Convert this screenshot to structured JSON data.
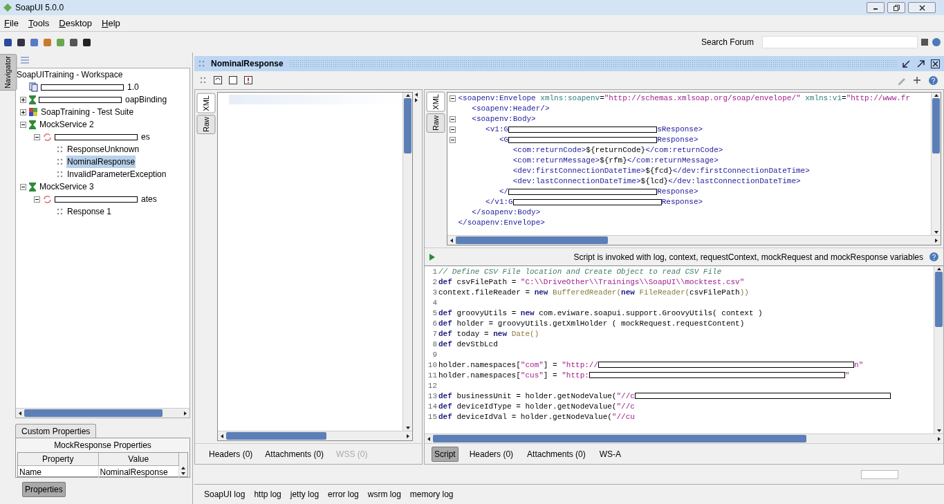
{
  "window": {
    "title": "SoapUI 5.0.0"
  },
  "menu": [
    {
      "label": "File"
    },
    {
      "label": "Tools"
    },
    {
      "label": "Desktop"
    },
    {
      "label": "Help"
    }
  ],
  "toolbar": {
    "search_label": "Search Forum"
  },
  "navigator": {
    "tab": "Navigator",
    "tree": [
      {
        "kind": "workspace",
        "label": "SoapUITraining - Workspace",
        "selected": false,
        "children": [
          {
            "kind": "project",
            "label": "1.0",
            "redacted": true,
            "selected": false
          },
          {
            "kind": "interface",
            "label": "oapBinding",
            "redacted": true,
            "expanded": false,
            "selected": false
          },
          {
            "kind": "suite",
            "label": "SoapTraining - Test Suite",
            "redacted": false,
            "expanded": false,
            "selected": false
          },
          {
            "kind": "mock",
            "label": "MockService 2",
            "redacted": false,
            "expanded": true,
            "selected": false,
            "children": [
              {
                "kind": "operation",
                "label": "es",
                "redacted": true,
                "expanded": true,
                "selected": false,
                "children": [
                  {
                    "kind": "response",
                    "label": "ResponseUnknown",
                    "redacted": false,
                    "selected": false
                  },
                  {
                    "kind": "response",
                    "label": "NominalResponse",
                    "redacted": false,
                    "selected": true
                  },
                  {
                    "kind": "response",
                    "label": "InvalidParameterException",
                    "redacted": false,
                    "selected": false
                  }
                ]
              }
            ]
          },
          {
            "kind": "mock",
            "label": "MockService 3",
            "redacted": false,
            "expanded": true,
            "selected": false,
            "children": [
              {
                "kind": "operation",
                "label": "ates",
                "redacted": true,
                "expanded": true,
                "selected": false,
                "children": [
                  {
                    "kind": "response",
                    "label": "Response 1",
                    "redacted": false,
                    "selected": false
                  }
                ]
              }
            ]
          }
        ]
      }
    ]
  },
  "properties": {
    "tab": "Custom Properties",
    "title": "MockResponse Properties",
    "columns": [
      "Property",
      "Value"
    ],
    "rows": [
      [
        "Name",
        "NominalResponse"
      ]
    ],
    "button": {
      "label": "Properties",
      "selected": true
    }
  },
  "editor": {
    "title": "NominalResponse",
    "request": {
      "side_tabs": [
        {
          "label": "XML",
          "selected": true
        },
        {
          "label": "Raw",
          "selected": false
        }
      ],
      "tabs": [
        {
          "label": "Headers (0)",
          "selected": false,
          "disabled": false
        },
        {
          "label": "Attachments (0)",
          "selected": false,
          "disabled": false
        },
        {
          "label": "WSS (0)",
          "selected": false,
          "disabled": true
        }
      ]
    },
    "response": {
      "side_tabs": [
        {
          "label": "XML",
          "selected": true
        },
        {
          "label": "Raw",
          "selected": false
        }
      ],
      "xml_lines": [
        {
          "fold": true,
          "segs": [
            {
              "kind": "tag",
              "text": "<soapenv:Envelope"
            },
            {
              "kind": "attr",
              "text": " xmlns:soapenv"
            },
            {
              "kind": "plain",
              "text": "="
            },
            {
              "kind": "val",
              "text": "\"http://schemas.xmlsoap.org/soap/envelope/\""
            },
            {
              "kind": "attr",
              "text": " xmlns:v1"
            },
            {
              "kind": "plain",
              "text": "="
            },
            {
              "kind": "val",
              "text": "\"http://www.fr"
            }
          ]
        },
        {
          "fold": false,
          "segs": [
            {
              "kind": "tag",
              "text": "   <soapenv:Header/>"
            }
          ]
        },
        {
          "fold": true,
          "segs": [
            {
              "kind": "tag",
              "text": "   <soapenv:Body>"
            }
          ]
        },
        {
          "fold": true,
          "segs": [
            {
              "kind": "tag",
              "text": "      <v1:G"
            },
            {
              "kind": "redact"
            },
            {
              "kind": "tag",
              "text": "sResponse>"
            }
          ]
        },
        {
          "fold": true,
          "segs": [
            {
              "kind": "tag",
              "text": "         <G"
            },
            {
              "kind": "redact"
            },
            {
              "kind": "tag",
              "text": "Response>"
            }
          ]
        },
        {
          "fold": false,
          "segs": [
            {
              "kind": "tag",
              "text": "            <com:returnCode>"
            },
            {
              "kind": "plain",
              "text": "${returnCode}"
            },
            {
              "kind": "tag",
              "text": "</com:returnCode>"
            }
          ]
        },
        {
          "fold": false,
          "segs": [
            {
              "kind": "tag",
              "text": "            <com:returnMessage>"
            },
            {
              "kind": "plain",
              "text": "${rfm}"
            },
            {
              "kind": "tag",
              "text": "</com:returnMessage>"
            }
          ]
        },
        {
          "fold": false,
          "segs": [
            {
              "kind": "tag",
              "text": "            <dev:firstConnectionDateTime>"
            },
            {
              "kind": "plain",
              "text": "${fcd}"
            },
            {
              "kind": "tag",
              "text": "</dev:firstConnectionDateTime>"
            }
          ]
        },
        {
          "fold": false,
          "segs": [
            {
              "kind": "tag",
              "text": "            <dev:lastConnectionDateTime>"
            },
            {
              "kind": "plain",
              "text": "${lcd}"
            },
            {
              "kind": "tag",
              "text": "</dev:lastConnectionDateTime>"
            }
          ]
        },
        {
          "fold": false,
          "segs": [
            {
              "kind": "tag",
              "text": "         </"
            },
            {
              "kind": "redact"
            },
            {
              "kind": "tag",
              "text": "Response>"
            }
          ]
        },
        {
          "fold": false,
          "segs": [
            {
              "kind": "tag",
              "text": "      </v1:G"
            },
            {
              "kind": "redact"
            },
            {
              "kind": "tag",
              "text": "Response>"
            }
          ]
        },
        {
          "fold": false,
          "segs": [
            {
              "kind": "tag",
              "text": "   </soapenv:Body>"
            }
          ]
        },
        {
          "fold": false,
          "segs": [
            {
              "kind": "tag",
              "text": "</soapenv:Envelope>"
            }
          ]
        }
      ],
      "script_note": "Script is invoked with log, context, requestContext, mockRequest and mockResponse variables",
      "script_lines": [
        {
          "n": "1",
          "segs": [
            {
              "kind": "comment",
              "text": "// Define CSV File location and Create Object to read CSV File"
            }
          ]
        },
        {
          "n": "2",
          "segs": [
            {
              "kind": "kw",
              "text": "def"
            },
            {
              "kind": "plain",
              "text": " csvFilePath = "
            },
            {
              "kind": "str",
              "text": "\"C:\\\\DriveOther\\\\Trainings\\\\SoapUI\\\\mocktest.csv\""
            }
          ]
        },
        {
          "n": "3",
          "segs": [
            {
              "kind": "plain",
              "text": "context.fileReader = "
            },
            {
              "kind": "kw",
              "text": "new"
            },
            {
              "kind": "cls",
              "text": " BufferedReader("
            },
            {
              "kind": "kw",
              "text": "new"
            },
            {
              "kind": "cls",
              "text": " FileReader("
            },
            {
              "kind": "plain",
              "text": "csvFilePath"
            },
            {
              "kind": "cls",
              "text": "))"
            }
          ]
        },
        {
          "n": "4"
        },
        {
          "n": "5",
          "segs": [
            {
              "kind": "kw",
              "text": "def"
            },
            {
              "kind": "plain",
              "text": " groovyUtils = "
            },
            {
              "kind": "kw",
              "text": "new"
            },
            {
              "kind": "plain",
              "text": " com.eviware.soapui.support.GroovyUtils( context )"
            }
          ]
        },
        {
          "n": "6",
          "segs": [
            {
              "kind": "kw",
              "text": "def"
            },
            {
              "kind": "plain",
              "text": " holder = groovyUtils.getXmlHolder ( mockRequest.requestContent)"
            }
          ]
        },
        {
          "n": "7",
          "segs": [
            {
              "kind": "kw",
              "text": "def"
            },
            {
              "kind": "plain",
              "text": " today = "
            },
            {
              "kind": "kw",
              "text": "new"
            },
            {
              "kind": "cls",
              "text": " Date()"
            }
          ]
        },
        {
          "n": "8",
          "segs": [
            {
              "kind": "kw",
              "text": "def"
            },
            {
              "kind": "plain",
              "text": " devStbLcd"
            }
          ]
        },
        {
          "n": "9"
        },
        {
          "n": "10",
          "segs": [
            {
              "kind": "plain",
              "text": "holder.namespaces["
            },
            {
              "kind": "str",
              "text": "\"com\""
            },
            {
              "kind": "plain",
              "text": "] = "
            },
            {
              "kind": "str",
              "text": "\"http://"
            },
            {
              "kind": "redact"
            },
            {
              "kind": "str",
              "text": "n\""
            }
          ]
        },
        {
          "n": "11",
          "segs": [
            {
              "kind": "plain",
              "text": "holder.namespaces["
            },
            {
              "kind": "str",
              "text": "\"cus\""
            },
            {
              "kind": "plain",
              "text": "] = "
            },
            {
              "kind": "str",
              "text": "\"http:"
            },
            {
              "kind": "redact"
            },
            {
              "kind": "str",
              "text": "\""
            }
          ]
        },
        {
          "n": "12"
        },
        {
          "n": "13",
          "segs": [
            {
              "kind": "kw",
              "text": "def"
            },
            {
              "kind": "plain",
              "text": " businessUnit = holder.getNodeValue("
            },
            {
              "kind": "str",
              "text": "\"//c"
            },
            {
              "kind": "redact"
            }
          ]
        },
        {
          "n": "14",
          "segs": [
            {
              "kind": "kw",
              "text": "def"
            },
            {
              "kind": "plain",
              "text": " deviceIdType = holder.getNodeValue("
            },
            {
              "kind": "str",
              "text": "\"//c"
            }
          ]
        },
        {
          "n": "15",
          "segs": [
            {
              "kind": "kw",
              "text": "def"
            },
            {
              "kind": "plain",
              "text": " deviceIdVal = holder.getNodeValue("
            },
            {
              "kind": "str",
              "text": "\"//cu"
            }
          ]
        }
      ],
      "tabs": [
        {
          "label": "Script",
          "selected": true
        },
        {
          "label": "Headers (0)",
          "selected": false
        },
        {
          "label": "Attachments (0)",
          "selected": false
        },
        {
          "label": "WS-A",
          "selected": false
        }
      ]
    }
  },
  "logs": [
    {
      "label": "SoapUI log"
    },
    {
      "label": "http log"
    },
    {
      "label": "jetty log"
    },
    {
      "label": "error log"
    },
    {
      "label": "wsrm log"
    },
    {
      "label": "memory log"
    }
  ]
}
